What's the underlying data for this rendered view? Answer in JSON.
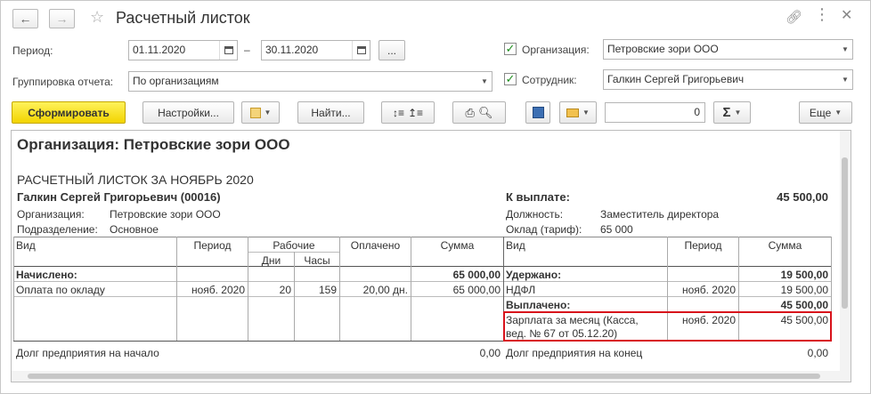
{
  "window": {
    "title": "Расчетный листок"
  },
  "form": {
    "period_label": "Период:",
    "date_from": "01.11.2020",
    "dash": "–",
    "date_to": "30.11.2020",
    "more_btn": "...",
    "grouping_label": "Группировка отчета:",
    "grouping_value": "По организациям",
    "org_label": "Организация:",
    "org_value": "Петровские зори ООО",
    "emp_label": "Сотрудник:",
    "emp_value": "Галкин Сергей Григорьевич"
  },
  "toolbar": {
    "generate": "Сформировать",
    "settings": "Настройки...",
    "find": "Найти...",
    "number_value": "0",
    "sigma": "Σ",
    "more": "Еще"
  },
  "report": {
    "org_header": "Организация: Петровские зори ООО",
    "sheet_title": "РАСЧЕТНЫЙ ЛИСТОК ЗА НОЯБРЬ 2020",
    "employee": "Галкин Сергей Григорьевич (00016)",
    "org_label": "Организация:",
    "org_value": "Петровские зори ООО",
    "dept_label": "Подразделение:",
    "dept_value": "Основное",
    "to_pay_label": "К выплате:",
    "to_pay_value": "45 500,00",
    "position_label": "Должность:",
    "position_value": "Заместитель директора",
    "salary_label": "Оклад (тариф):",
    "salary_value": "65 000",
    "left_headers": {
      "kind": "Вид",
      "period": "Период",
      "working": "Рабочие",
      "days": "Дни",
      "hours": "Часы",
      "paid": "Оплачено",
      "sum": "Сумма"
    },
    "right_headers": {
      "kind": "Вид",
      "period": "Период",
      "sum": "Сумма"
    },
    "accrued_label": "Начислено:",
    "accrued_total": "65 000,00",
    "accrual_row": {
      "kind": "Оплата по окладу",
      "period": "нояб. 2020",
      "days": "20",
      "hours": "159",
      "paid": "20,00 дн.",
      "sum": "65 000,00"
    },
    "withheld_label": "Удержано:",
    "withheld_total": "19 500,00",
    "ndfl_row": {
      "kind": "НДФЛ",
      "period": "нояб. 2020",
      "sum": "19 500,00"
    },
    "paid_label": "Выплачено:",
    "paid_total": "45 500,00",
    "payout_row": {
      "kind_line1": "Зарплата за месяц (Касса,",
      "kind_line2": "вед. № 67 от 05.12.20)",
      "period": "нояб. 2020",
      "sum": "45 500,00"
    },
    "debt_start_label": "Долг предприятия на начало",
    "debt_start_value": "0,00",
    "debt_end_label": "Долг предприятия на конец",
    "debt_end_value": "0,00"
  }
}
